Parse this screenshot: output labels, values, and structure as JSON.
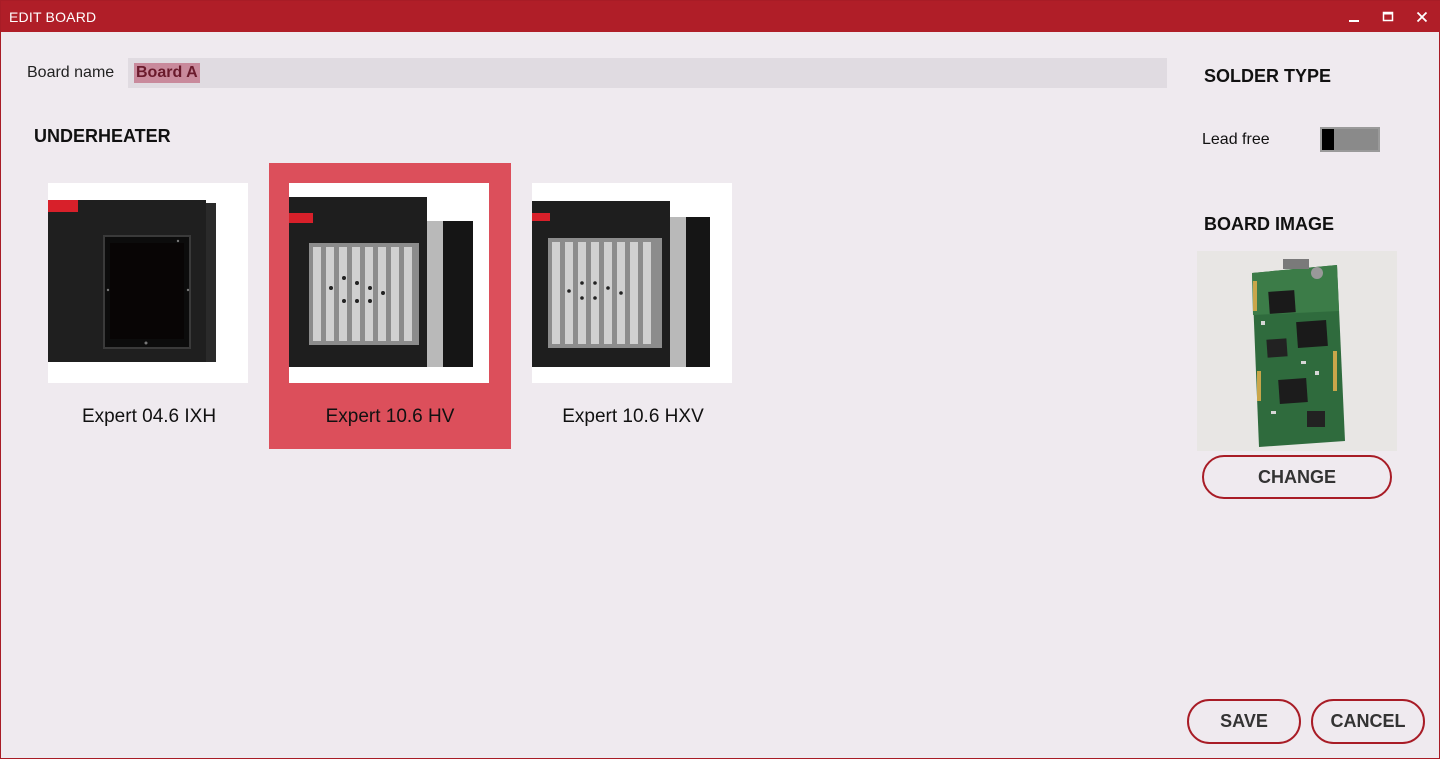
{
  "window": {
    "title": "EDIT BOARD",
    "controls": {
      "minimize_icon": "minimize-icon",
      "maximize_icon": "maximize-icon",
      "close_icon": "close-icon"
    }
  },
  "board_name": {
    "label": "Board name",
    "value": "Board A"
  },
  "underheater": {
    "title": "UNDERHEATER",
    "options": [
      {
        "name": "Expert 04.6 IXH",
        "selected": false
      },
      {
        "name": "Expert 10.6 HV",
        "selected": true
      },
      {
        "name": "Expert 10.6 HXV",
        "selected": false
      }
    ]
  },
  "solder_type": {
    "title": "SOLDER TYPE",
    "lead_free_label": "Lead free",
    "lead_free_enabled": false
  },
  "board_image": {
    "title": "BOARD IMAGE",
    "change_label": "CHANGE"
  },
  "actions": {
    "save_label": "SAVE",
    "cancel_label": "CANCEL"
  },
  "colors": {
    "accent": "#b01e28",
    "selected_card": "#dc4f5b",
    "background": "#efeaef",
    "input_bg": "#e0dbe1"
  }
}
